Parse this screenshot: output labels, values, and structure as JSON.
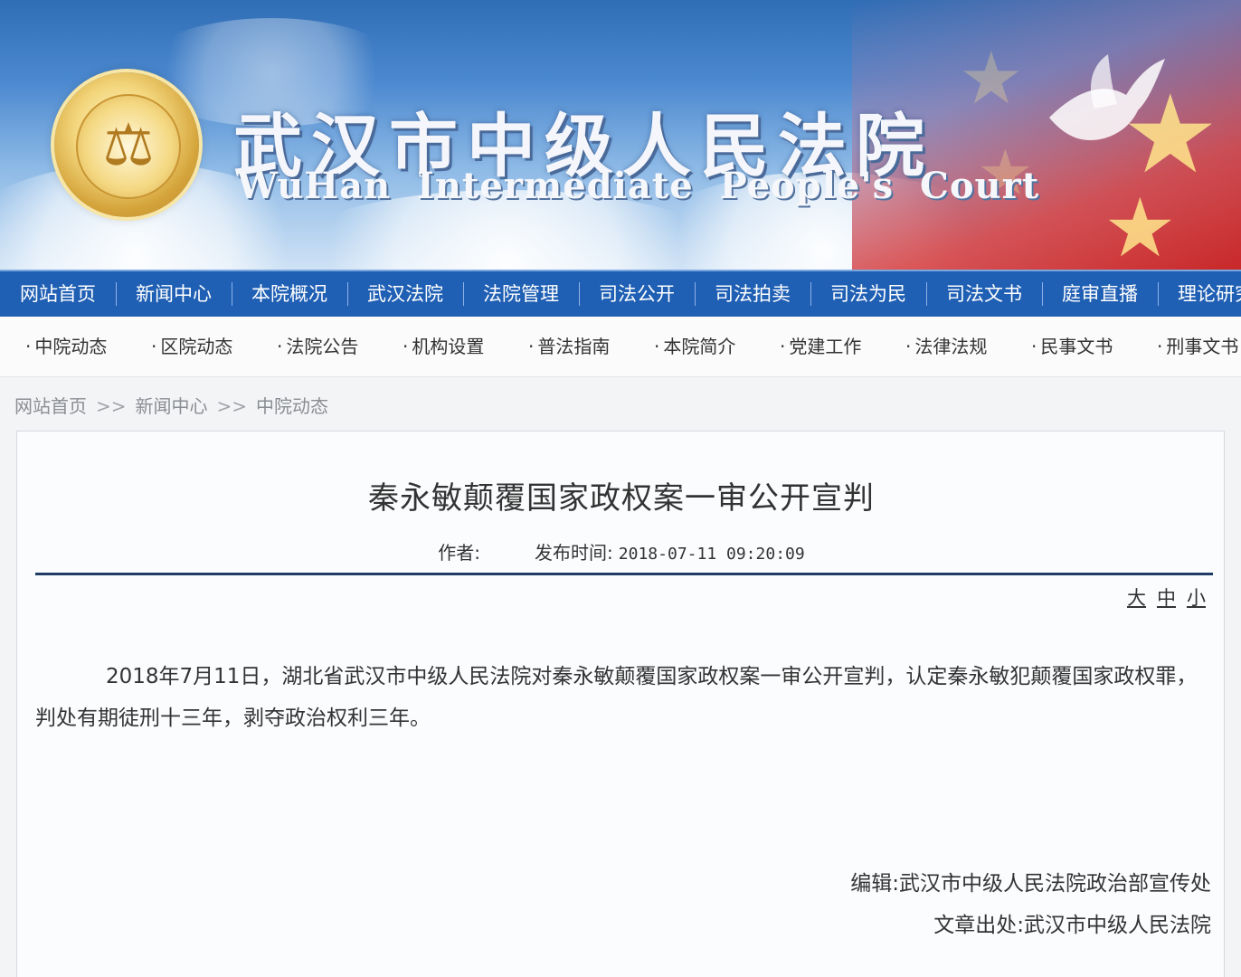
{
  "header": {
    "title_cn": "武汉市中级人民法院",
    "title_en": "WuHan Intermediate People's Court"
  },
  "main_nav": [
    "网站首页",
    "新闻中心",
    "本院概况",
    "武汉法院",
    "法院管理",
    "司法公开",
    "司法拍卖",
    "司法为民",
    "司法文书",
    "庭审直播",
    "理论研究"
  ],
  "sub_nav": [
    "中院动态",
    "区院动态",
    "法院公告",
    "机构设置",
    "普法指南",
    "本院简介",
    "党建工作",
    "法律法规",
    "民事文书",
    "刑事文书"
  ],
  "breadcrumb": {
    "items": [
      "网站首页",
      "新闻中心",
      "中院动态"
    ],
    "separator": ">>"
  },
  "article": {
    "title": "秦永敏颠覆国家政权案一审公开宣判",
    "author_label": "作者:",
    "time_label": "发布时间:",
    "time_value": "2018-07-11 09:20:09",
    "font_size_options": [
      "大",
      "中",
      "小"
    ],
    "body": "2018年7月11日，湖北省武汉市中级人民法院对秦永敏颠覆国家政权案一审公开宣判，认定秦永敏犯颠覆国家政权罪，判处有期徒刑十三年，剥夺政治权利三年。",
    "editor": "编辑:武汉市中级人民法院政治部宣传处",
    "source": "文章出处:武汉市中级人民法院"
  },
  "colors": {
    "nav_blue": "#1f5fb4",
    "rule": "#1f3b66",
    "flag_red": "#d23a3a"
  }
}
